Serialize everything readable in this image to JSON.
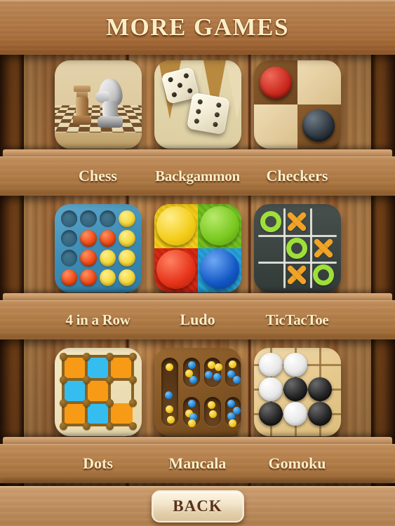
{
  "header": {
    "title": "MORE GAMES"
  },
  "footer": {
    "back_label": "BACK"
  },
  "rows": [
    {
      "games": [
        {
          "label": "Chess",
          "icon": "chess-icon"
        },
        {
          "label": "Backgammon",
          "icon": "backgammon-icon"
        },
        {
          "label": "Checkers",
          "icon": "checkers-icon"
        }
      ]
    },
    {
      "games": [
        {
          "label": "4 in a Row",
          "icon": "four-in-a-row-icon"
        },
        {
          "label": "Ludo",
          "icon": "ludo-icon"
        },
        {
          "label": "TicTacToe",
          "icon": "tictactoe-icon"
        }
      ]
    },
    {
      "games": [
        {
          "label": "Dots",
          "icon": "dots-icon"
        },
        {
          "label": "Mancala",
          "icon": "mancala-icon"
        },
        {
          "label": "Gomoku",
          "icon": "gomoku-icon"
        }
      ]
    }
  ],
  "colors": {
    "title_text": "#fbeec6",
    "shelf_wood": "#b8834f",
    "background_wood": "#a8692f",
    "back_button_face": "#f3e6cc",
    "back_button_text": "#5a3118",
    "checkers_red": "#c8281c",
    "checkers_black": "#2b343c",
    "connect4_board": "#3d8cb5",
    "connect4_red": "#f04a16",
    "connect4_yellow": "#f5d93c",
    "ludo_yellow": "#f2cc1b",
    "ludo_green": "#74c022",
    "ludo_red": "#d62a16",
    "ludo_blue": "#1565c9",
    "tictactoe_board": "#3b4441",
    "tictactoe_o": "#9fe038",
    "tictactoe_x": "#f0a326",
    "dots_orange": "#f79b16",
    "dots_cyan": "#35bdf0",
    "mancala_bead_yellow": "#f0c419",
    "mancala_bead_blue": "#1f84d6"
  },
  "board_states": {
    "checkers": [
      [
        "red",
        "empty"
      ],
      [
        "empty",
        "black"
      ]
    ],
    "four_in_a_row": [
      [
        "empty",
        "empty",
        "empty",
        "yellow"
      ],
      [
        "empty",
        "red",
        "red",
        "yellow"
      ],
      [
        "empty",
        "red",
        "yellow",
        "yellow"
      ],
      [
        "red",
        "red",
        "yellow",
        "yellow"
      ]
    ],
    "ludo": [
      [
        "yellow",
        "green"
      ],
      [
        "red",
        "blue"
      ]
    ],
    "tictactoe": [
      [
        "O",
        "X",
        ""
      ],
      [
        "",
        "O",
        "X"
      ],
      [
        "",
        "X",
        "O"
      ]
    ],
    "dots": [
      [
        "orange",
        "cyan",
        "orange"
      ],
      [
        "cyan",
        "orange",
        "empty"
      ],
      [
        "orange",
        "cyan",
        "orange"
      ]
    ],
    "gomoku": [
      [
        "white",
        "white",
        "empty"
      ],
      [
        "white",
        "black",
        "black"
      ],
      [
        "black",
        "white",
        "black"
      ]
    ],
    "backgammon_dice": [
      5,
      6
    ]
  }
}
